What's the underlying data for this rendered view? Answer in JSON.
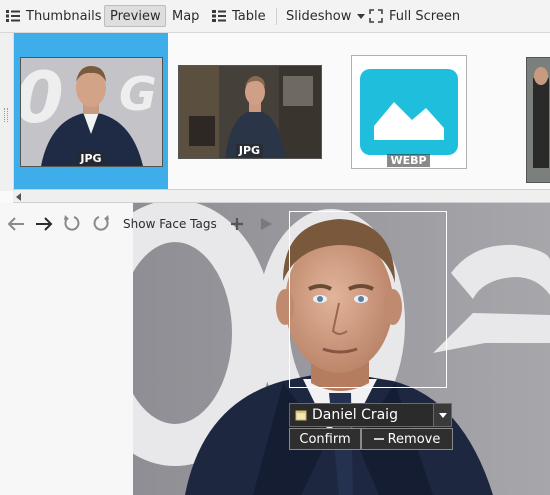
{
  "toolbar": {
    "thumbnails_label": "Thumbnails",
    "preview_label": "Preview",
    "map_label": "Map",
    "table_label": "Table",
    "slideshow_label": "Slideshow",
    "fullscreen_label": "Full Screen"
  },
  "thumbnails": [
    {
      "format": "JPG",
      "selected": true
    },
    {
      "format": "JPG",
      "selected": false
    },
    {
      "format": "WEBP",
      "selected": false
    },
    {
      "format": "",
      "selected": false
    }
  ],
  "nav": {
    "show_face_tags_label": "Show Face Tags"
  },
  "face_tag": {
    "name": "Daniel Craig",
    "confirm_label": "Confirm",
    "remove_label": "Remove"
  },
  "colors": {
    "selection": "#3daee9",
    "webp_icon": "#1ebedc",
    "toolbar_bg": "#f3f3f3"
  }
}
